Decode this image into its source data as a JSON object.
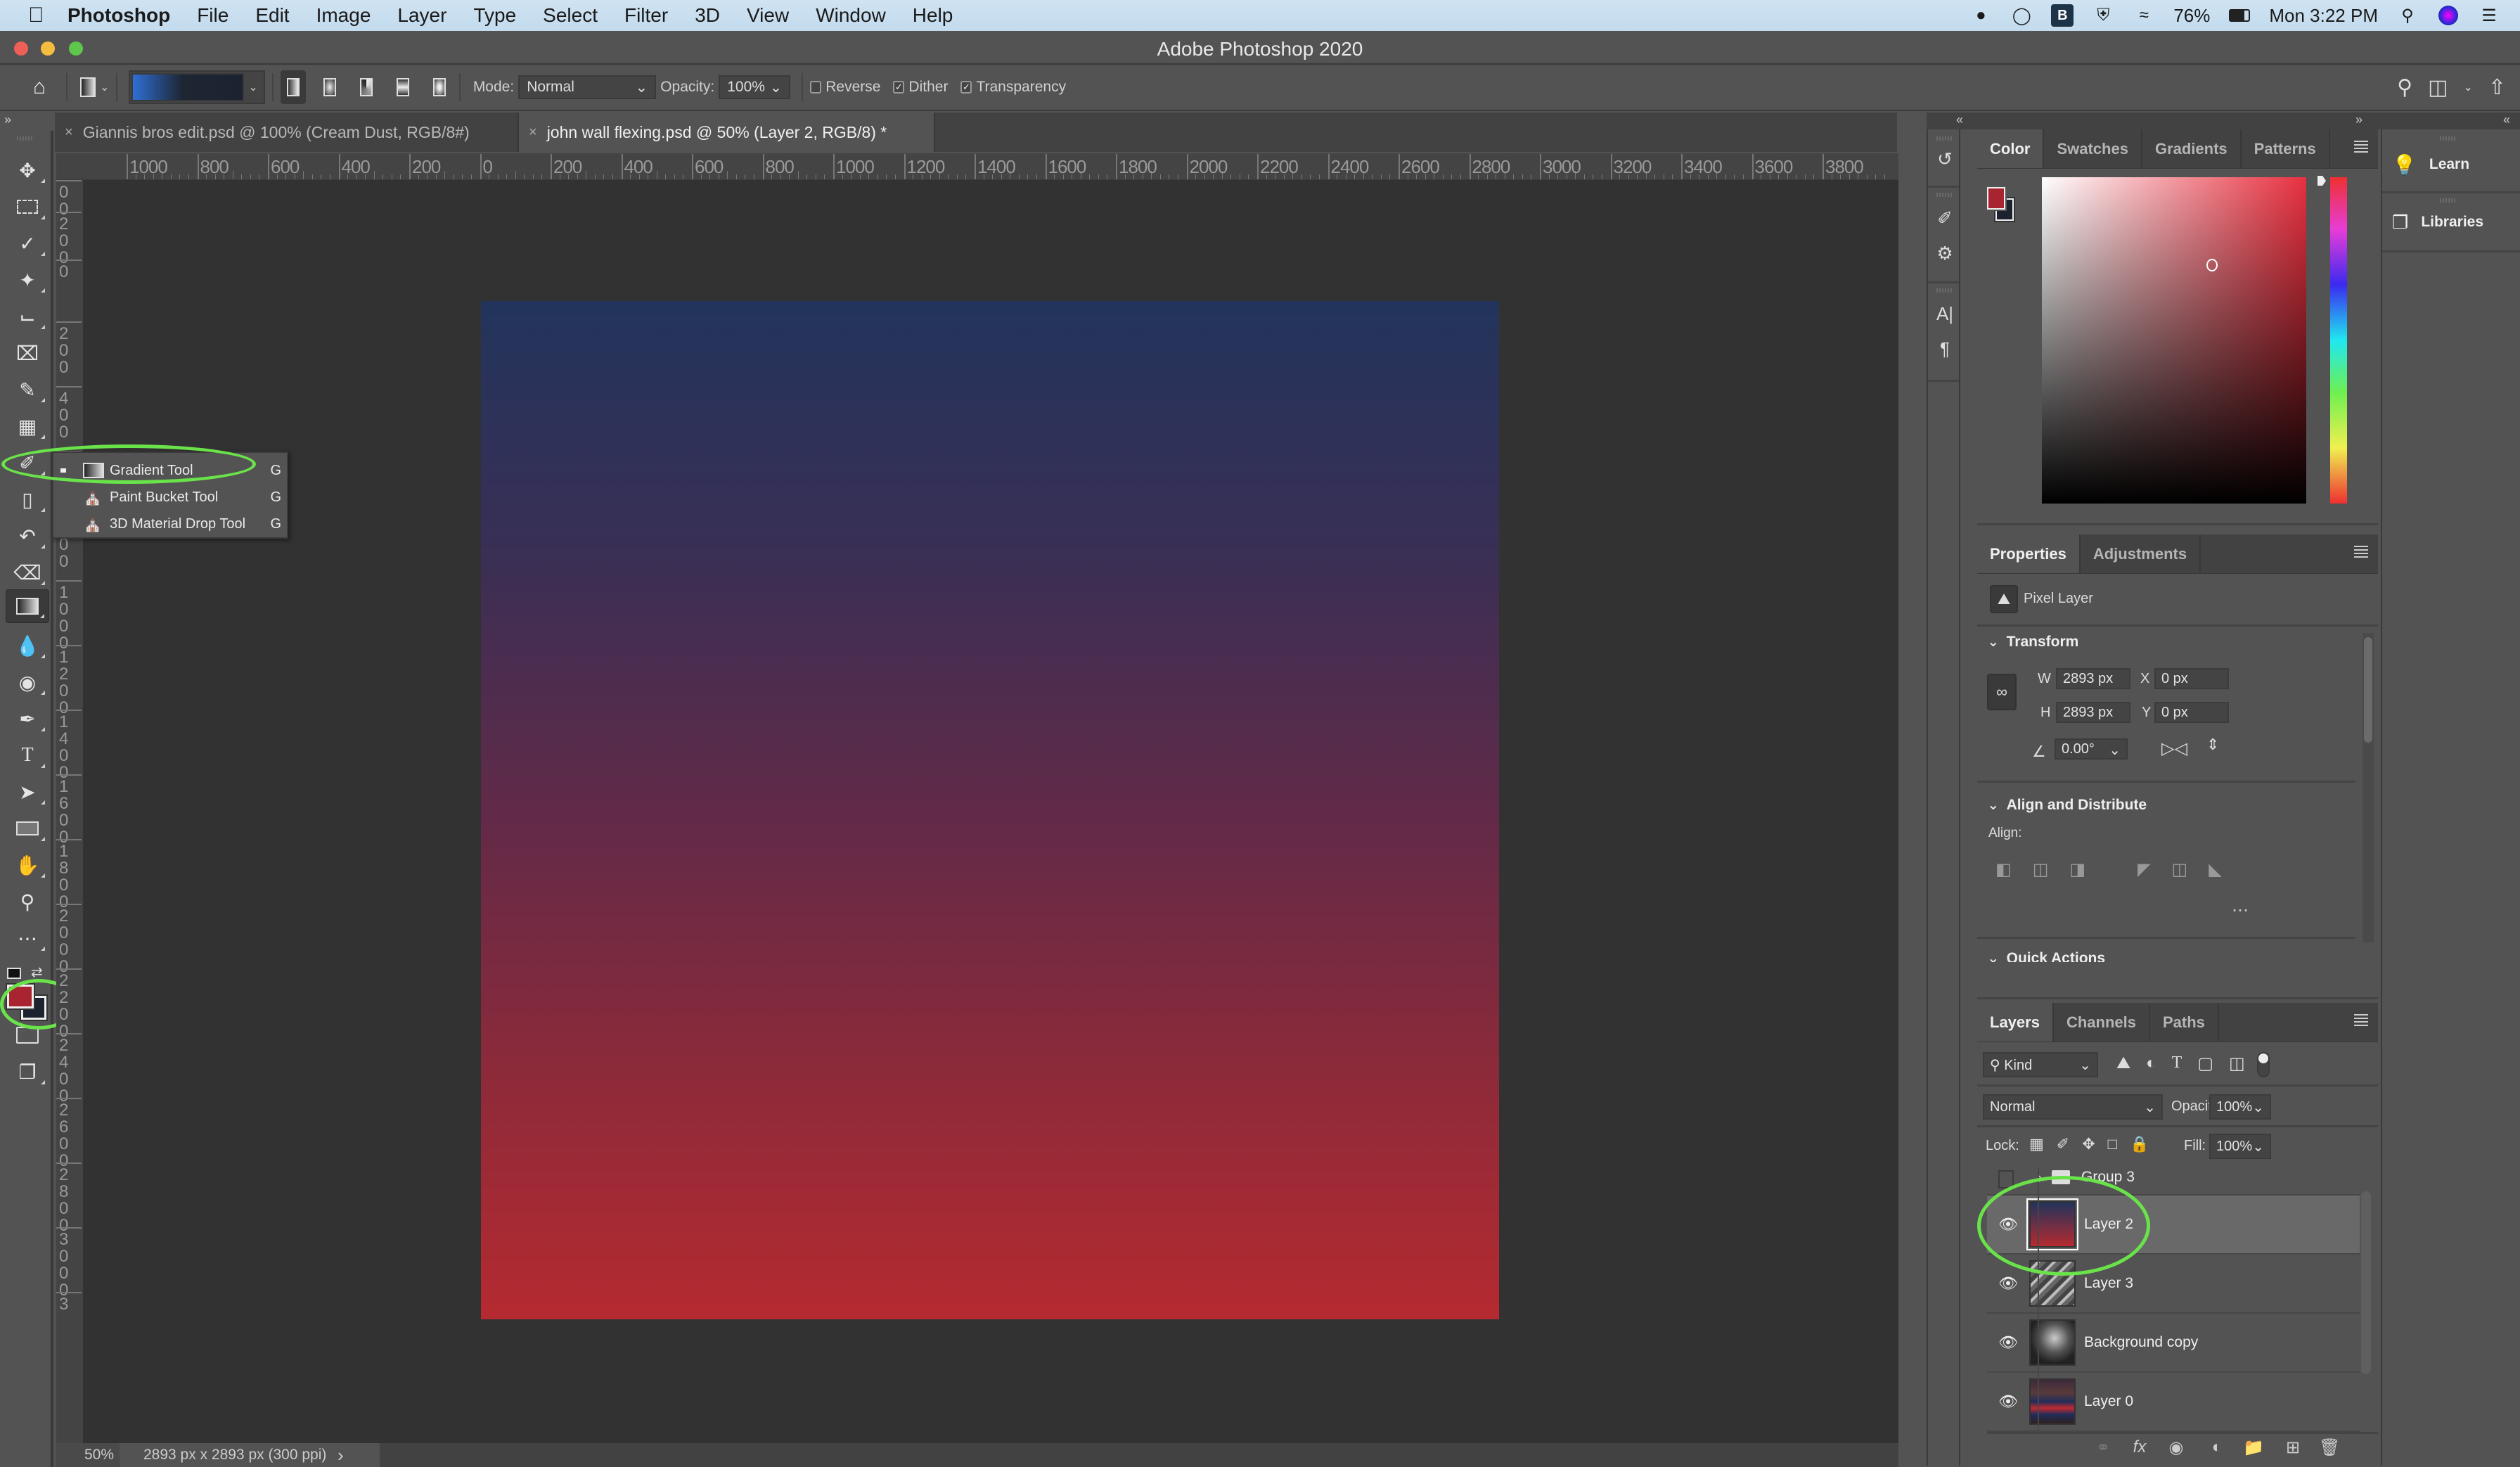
{
  "menubar": {
    "app_name": "Photoshop",
    "items": [
      "File",
      "Edit",
      "Image",
      "Layer",
      "Type",
      "Select",
      "Filter",
      "3D",
      "View",
      "Window",
      "Help"
    ],
    "battery": "76%",
    "clock": "Mon 3:22 PM"
  },
  "window": {
    "title": "Adobe Photoshop 2020"
  },
  "options_bar": {
    "mode_label": "Mode:",
    "mode_value": "Normal",
    "opacity_label": "Opacity:",
    "opacity_value": "100%",
    "reverse_label": "Reverse",
    "reverse_checked": false,
    "dither_label": "Dither",
    "dither_checked": true,
    "transparency_label": "Transparency",
    "transparency_checked": true,
    "gradient_colors": [
      "#2e6fd4",
      "#1c2230"
    ]
  },
  "tabs": [
    {
      "label": "Giannis bros edit.psd @ 100% (Cream Dust, RGB/8#)",
      "active": false
    },
    {
      "label": "john wall flexing.psd @ 50% (Layer 2, RGB/8) *",
      "active": true
    }
  ],
  "rulers": {
    "horizontal": [
      "1000",
      "800",
      "600",
      "400",
      "200",
      "0",
      "200",
      "400",
      "600",
      "800",
      "1000",
      "1200",
      "1400",
      "1600",
      "1800",
      "2000",
      "2200",
      "2400",
      "2600",
      "2800",
      "3000",
      "3200",
      "3400",
      "3600",
      "3800"
    ],
    "vertical": [
      "00",
      "200",
      "0",
      "200",
      "400",
      "600",
      "800",
      "1000",
      "1200",
      "1400",
      "1600",
      "1800",
      "2000",
      "2200",
      "2400",
      "2600",
      "2800",
      "3000",
      "3"
    ]
  },
  "tool_flyout": {
    "items": [
      {
        "label": "Gradient Tool",
        "shortcut": "G",
        "selected": true
      },
      {
        "label": "Paint Bucket Tool",
        "shortcut": "G",
        "selected": false
      },
      {
        "label": "3D Material Drop Tool",
        "shortcut": "G",
        "selected": false
      }
    ]
  },
  "colors": {
    "foreground": "#a82431",
    "background": "#1c2230",
    "gradient_top": "#22345c",
    "gradient_bottom": "#b52a30",
    "highlight": "#6ae34a"
  },
  "status_bar": {
    "zoom": "50%",
    "doc_info": "2893 px x 2893 px (300 ppi)",
    "arrow": "›"
  },
  "color_panel": {
    "tabs": [
      "Color",
      "Swatches",
      "Gradients",
      "Patterns"
    ],
    "active_tab": "Color"
  },
  "right_panel_buttons": {
    "learn": "Learn",
    "libraries": "Libraries"
  },
  "properties_panel": {
    "tabs": [
      "Properties",
      "Adjustments"
    ],
    "layer_kind": "Pixel Layer",
    "transform_title": "Transform",
    "w_label": "W",
    "w_value": "2893 px",
    "h_label": "H",
    "h_value": "2893 px",
    "x_label": "X",
    "x_value": "0 px",
    "y_label": "Y",
    "y_value": "0 px",
    "angle_value": "0.00°",
    "align_title": "Align and Distribute",
    "align_label": "Align:",
    "quick_actions_title": "Quick Actions"
  },
  "layers_panel": {
    "tabs": [
      "Layers",
      "Channels",
      "Paths"
    ],
    "filter_kind": "Kind",
    "blend_mode": "Normal",
    "opacity_label": "Opacity:",
    "opacity_value": "100%",
    "lock_label": "Lock:",
    "fill_label": "Fill:",
    "fill_value": "100%",
    "layers": [
      {
        "name": "Group 3",
        "visible": false,
        "type": "group",
        "selected": false
      },
      {
        "name": "Layer 2",
        "visible": true,
        "type": "gradient",
        "selected": true
      },
      {
        "name": "Layer 3",
        "visible": true,
        "type": "texture",
        "selected": false
      },
      {
        "name": "Background copy",
        "visible": true,
        "type": "photo-bw",
        "selected": false
      },
      {
        "name": "Layer 0",
        "visible": true,
        "type": "photo",
        "selected": false
      }
    ]
  }
}
